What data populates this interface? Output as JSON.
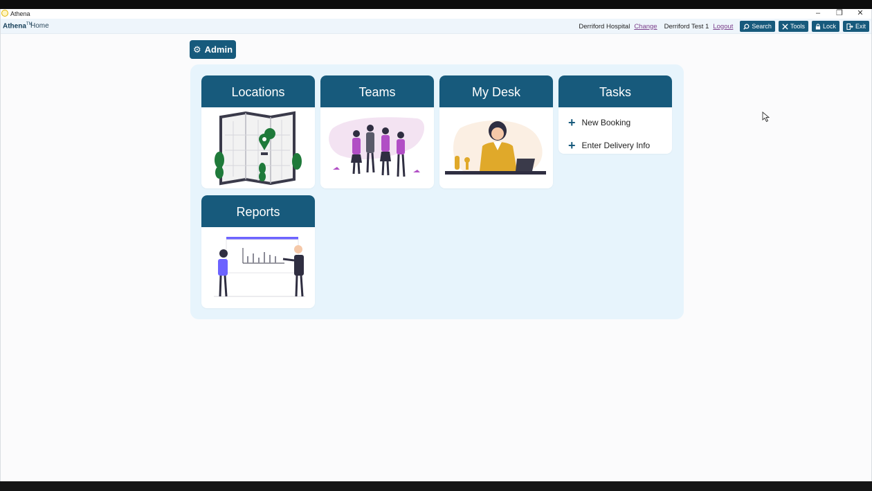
{
  "window": {
    "title": "Athena"
  },
  "navbar": {
    "brand": "Athena",
    "brand_mark": "TM",
    "breadcrumb": "Home",
    "site": "Derriford Hospital",
    "change_link": "Change",
    "user": "Derriford Test 1",
    "logout_link": "Logout",
    "buttons": {
      "search": "Search",
      "tools": "Tools",
      "lock": "Lock",
      "exit": "Exit"
    }
  },
  "admin": {
    "label": "Admin"
  },
  "tiles": {
    "locations": "Locations",
    "teams": "Teams",
    "mydesk": "My Desk",
    "tasks": "Tasks",
    "reports": "Reports"
  },
  "tasks": {
    "items": [
      "New Booking",
      "Enter Delivery Info"
    ]
  },
  "colors": {
    "primary": "#175a7c",
    "panel": "#e7f4fc",
    "link": "#7a3e8a"
  }
}
